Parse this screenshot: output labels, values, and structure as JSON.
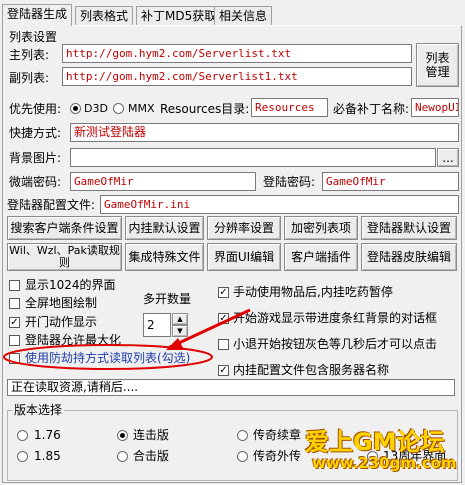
{
  "tabs": [
    "登陆器生成",
    "列表格式",
    "补丁MD5获取",
    "相关信息"
  ],
  "list_settings": {
    "title": "列表设置",
    "main_list_label": "主列表:",
    "main_list_value": "http://gom.hym2.com/Serverlist.txt",
    "sub_list_label": "副列表:",
    "sub_list_value": "http://gom.hym2.com/Serverlist1.txt",
    "manage_button": "列表管理"
  },
  "priority": {
    "label": "优先使用:",
    "d3d": "D3D",
    "mmx": "MMX",
    "resources_label": "Resources目录:",
    "resources_value": "Resources",
    "patch_name_label": "必备补丁名称:",
    "patch_name_value": "NewopUI"
  },
  "shortcut": {
    "label": "快捷方式:",
    "value": "新测试登陆器"
  },
  "background": {
    "label": "背景图片:",
    "value": "",
    "browse": "..."
  },
  "micro_password": {
    "label": "微端密码:",
    "value": "GameOfMir"
  },
  "login_password": {
    "label": "登陆密码:",
    "value": "GameOfMir"
  },
  "config_file": {
    "label": "登陆器配置文件:",
    "value": "GameOfMir.ini"
  },
  "buttons_row1": [
    "搜索客户端条件设置",
    "内挂默认设置",
    "分辨率设置",
    "加密列表项",
    "登陆器默认设置"
  ],
  "buttons_row2": [
    "Wil、Wzl、Pak读取规则",
    "集成特殊文件",
    "界面UI编辑",
    "客户端插件",
    "登陆器皮肤编辑"
  ],
  "options_left": [
    {
      "label": "显示1024的界面",
      "checked": false
    },
    {
      "label": "全屏地图绘制",
      "checked": false
    },
    {
      "label": "开门动作显示",
      "checked": true
    },
    {
      "label": "登陆器允许最大化",
      "checked": false
    },
    {
      "label": "使用防劫持方式读取列表(勾选)",
      "checked": false
    }
  ],
  "multi_open": {
    "label": "多开数量",
    "value": "2"
  },
  "options_right": [
    {
      "label": "手动使用物品后,内挂吃药暂停",
      "checked": true
    },
    {
      "label": "开始游戏显示带进度条红背景的对话框",
      "checked": true
    },
    {
      "label": "小退开始按钮灰色等几秒后才可以点击",
      "checked": false
    },
    {
      "label": "内挂配置文件包含服务器名称",
      "checked": true
    }
  ],
  "status": "正在读取资源,请稍后....",
  "version": {
    "title": "版本选择",
    "options": [
      {
        "label": "1.76",
        "selected": false
      },
      {
        "label": "连击版",
        "selected": true
      },
      {
        "label": "传奇续章",
        "selected": false
      },
      {
        "label": "1.85",
        "selected": false
      },
      {
        "label": "合击版",
        "selected": false
      },
      {
        "label": "传奇外传",
        "selected": false
      },
      {
        "label": "13周年界面",
        "selected": false
      }
    ]
  },
  "watermark": {
    "title": "爱上GM论坛",
    "url": "www.230gm.com"
  },
  "colors": {
    "red_text": "#c00000",
    "annotation": "#e00000",
    "highlight_text": "#1f3fa8"
  }
}
